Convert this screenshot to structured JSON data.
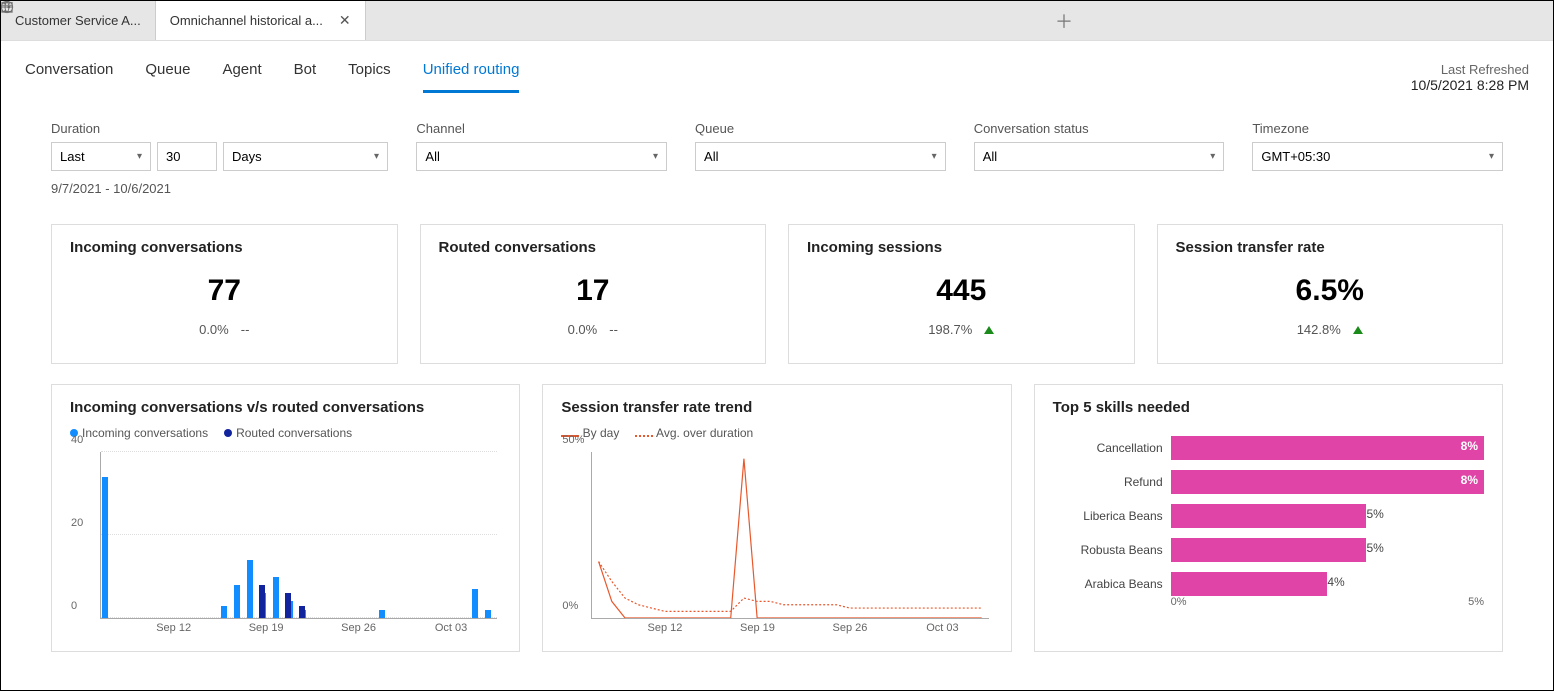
{
  "tabs": [
    {
      "label": "Customer Service A...",
      "active": false
    },
    {
      "label": "Omnichannel historical a...",
      "active": true
    }
  ],
  "nav": {
    "items": [
      "Conversation",
      "Queue",
      "Agent",
      "Bot",
      "Topics",
      "Unified routing"
    ],
    "activeIndex": 5,
    "refreshed_label": "Last Refreshed",
    "refreshed_ts": "10/5/2021 8:28 PM"
  },
  "filters": {
    "duration_label": "Duration",
    "duration_mode": "Last",
    "duration_n": "30",
    "duration_unit": "Days",
    "daterange": "9/7/2021 - 10/6/2021",
    "channel_label": "Channel",
    "channel_value": "All",
    "queue_label": "Queue",
    "queue_value": "All",
    "status_label": "Conversation status",
    "status_value": "All",
    "tz_label": "Timezone",
    "tz_value": "GMT+05:30"
  },
  "cards": [
    {
      "title": "Incoming conversations",
      "value": "77",
      "pct": "0.0%",
      "delta": "--"
    },
    {
      "title": "Routed conversations",
      "value": "17",
      "pct": "0.0%",
      "delta": "--"
    },
    {
      "title": "Incoming sessions",
      "value": "445",
      "pct": "198.7%",
      "delta": "up"
    },
    {
      "title": "Session transfer rate",
      "value": "6.5%",
      "pct": "142.8%",
      "delta": "up"
    }
  ],
  "chart_data": [
    {
      "type": "bar",
      "title": "Incoming conversations v/s routed conversations",
      "categories": [
        "Sep 07",
        "Sep 08",
        "Sep 09",
        "Sep 10",
        "Sep 11",
        "Sep 12",
        "Sep 13",
        "Sep 14",
        "Sep 15",
        "Sep 16",
        "Sep 17",
        "Sep 18",
        "Sep 19",
        "Sep 20",
        "Sep 21",
        "Sep 22",
        "Sep 23",
        "Sep 24",
        "Sep 25",
        "Sep 26",
        "Sep 27",
        "Sep 28",
        "Sep 29",
        "Sep 30",
        "Oct 01",
        "Oct 02",
        "Oct 03",
        "Oct 04",
        "Oct 05",
        "Oct 06"
      ],
      "series": [
        {
          "name": "Incoming conversations",
          "color": "#118dff",
          "values": [
            34,
            0,
            0,
            0,
            0,
            0,
            0,
            0,
            0,
            3,
            8,
            14,
            6,
            10,
            4,
            2,
            0,
            0,
            0,
            0,
            0,
            2,
            0,
            0,
            0,
            0,
            0,
            0,
            7,
            2
          ]
        },
        {
          "name": "Routed conversations",
          "color": "#12239e",
          "values": [
            0,
            0,
            0,
            0,
            0,
            0,
            0,
            0,
            0,
            0,
            0,
            8,
            0,
            6,
            3,
            0,
            0,
            0,
            0,
            0,
            0,
            0,
            0,
            0,
            0,
            0,
            0,
            0,
            0,
            0
          ]
        }
      ],
      "ylim": [
        0,
        40
      ],
      "xticks": [
        "Sep 12",
        "Sep 19",
        "Sep 26",
        "Oct 03"
      ]
    },
    {
      "type": "line",
      "title": "Session transfer rate trend",
      "categories": [
        "Sep 07",
        "Sep 08",
        "Sep 09",
        "Sep 10",
        "Sep 11",
        "Sep 12",
        "Sep 13",
        "Sep 14",
        "Sep 15",
        "Sep 16",
        "Sep 17",
        "Sep 18",
        "Sep 19",
        "Sep 20",
        "Sep 21",
        "Sep 22",
        "Sep 23",
        "Sep 24",
        "Sep 25",
        "Sep 26",
        "Sep 27",
        "Sep 28",
        "Sep 29",
        "Sep 30",
        "Oct 01",
        "Oct 02",
        "Oct 03",
        "Oct 04",
        "Oct 05",
        "Oct 06"
      ],
      "series": [
        {
          "name": "By day",
          "color": "#e8582c",
          "values": [
            17,
            5,
            0,
            0,
            0,
            0,
            0,
            0,
            0,
            0,
            0,
            48,
            0,
            0,
            0,
            0,
            0,
            0,
            0,
            0,
            0,
            0,
            0,
            0,
            0,
            0,
            0,
            0,
            0,
            0
          ]
        },
        {
          "name": "Avg. over duration",
          "color": "#e8582c",
          "style": "dotted",
          "values": [
            17,
            11,
            6,
            4,
            3,
            2,
            2,
            2,
            2,
            2,
            2,
            6,
            5,
            5,
            4,
            4,
            4,
            4,
            4,
            3,
            3,
            3,
            3,
            3,
            3,
            3,
            3,
            3,
            3,
            3
          ]
        }
      ],
      "ylim": [
        0,
        50
      ],
      "yunit": "%",
      "xticks": [
        "Sep 12",
        "Sep 19",
        "Sep 26",
        "Oct 03"
      ]
    },
    {
      "type": "bar",
      "title": "Top 5 skills needed",
      "orientation": "horizontal",
      "categories": [
        "Cancellation",
        "Refund",
        "Liberica Beans",
        "Robusta Beans",
        "Arabica Beans"
      ],
      "values": [
        8,
        8,
        5,
        5,
        4
      ],
      "xlim": [
        0,
        8
      ],
      "xunit": "%",
      "color": "#e044a7",
      "xticks": [
        "0%",
        "5%"
      ]
    }
  ]
}
